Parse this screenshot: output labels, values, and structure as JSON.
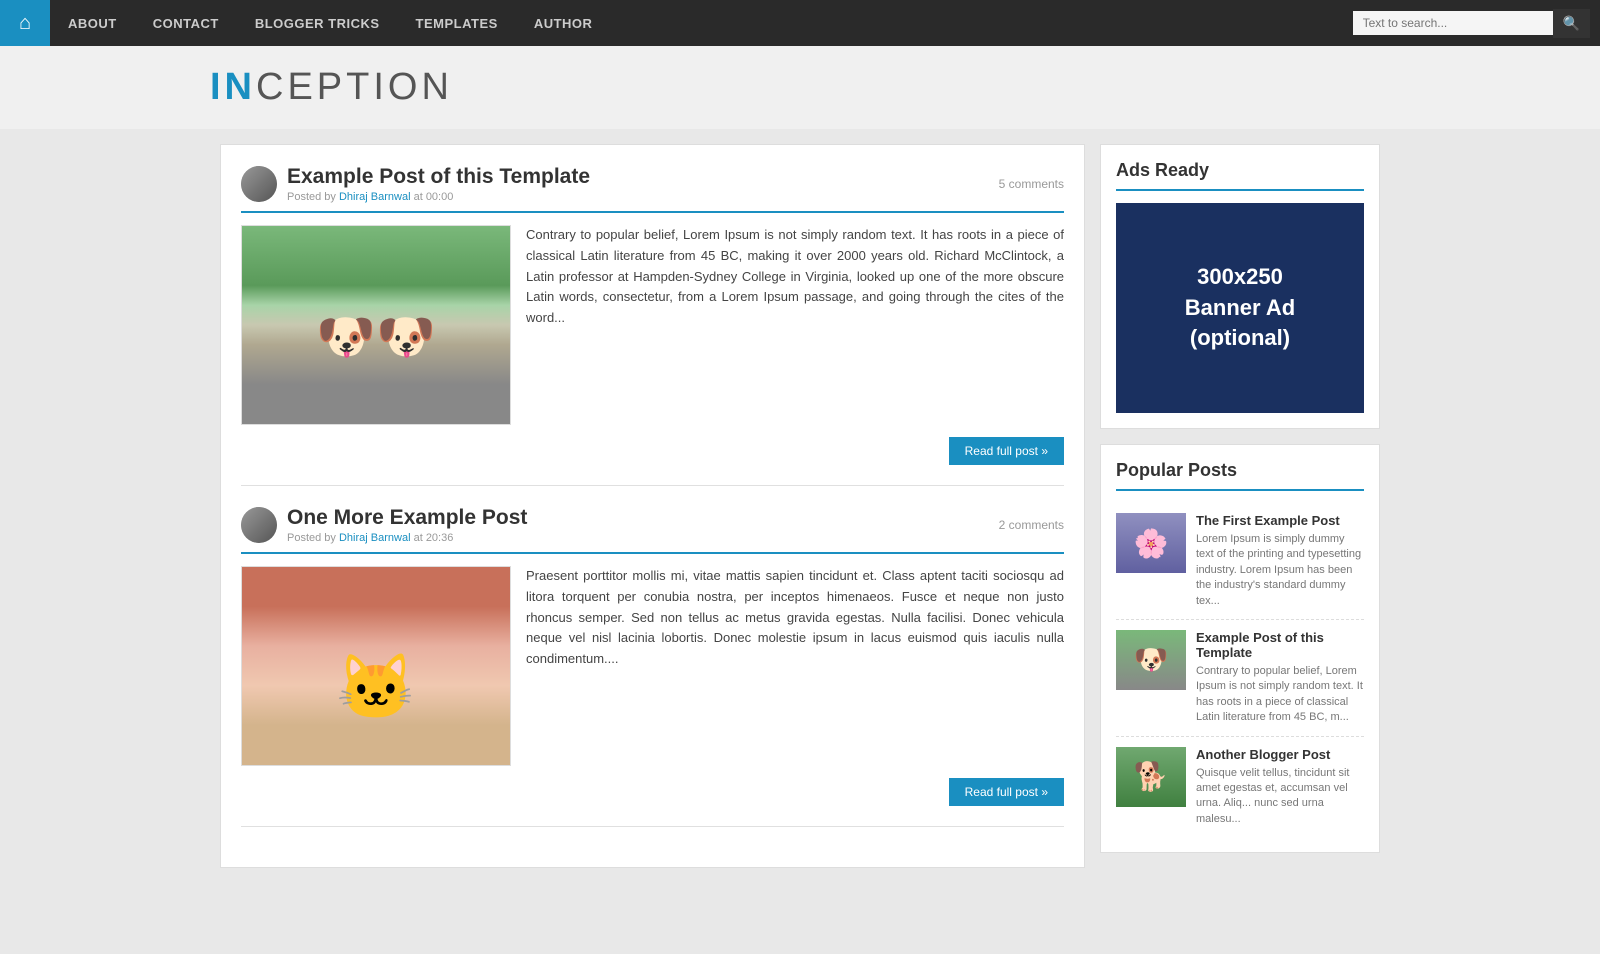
{
  "nav": {
    "home_icon": "⌂",
    "links": [
      {
        "id": "about",
        "label": "ABOUT"
      },
      {
        "id": "contact",
        "label": "CONTACT"
      },
      {
        "id": "blogger-tricks",
        "label": "BLOGGER TRICKS"
      },
      {
        "id": "templates",
        "label": "TEMPLATES"
      },
      {
        "id": "author",
        "label": "AUTHOR"
      }
    ],
    "search_placeholder": "Text to search...",
    "search_icon": "🔍"
  },
  "logo": {
    "part1": "IN",
    "part2": "CEPTION"
  },
  "posts": [
    {
      "id": "post1",
      "title": "Example Post of this Template",
      "author": "Dhiraj Barnwal",
      "time": "00:00",
      "comments": "5 comments",
      "image_type": "dogs",
      "excerpt": "Contrary to popular belief, Lorem Ipsum is not simply random text. It has roots in a piece of classical Latin literature from 45 BC, making it over 2000 years old. Richard McClintock, a Latin professor at Hampden-Sydney College in Virginia, looked up one of the more obscure Latin words, consectetur, from a Lorem Ipsum passage, and going through the cites of the word...",
      "read_more": "Read full post »",
      "posted_by": "Posted by"
    },
    {
      "id": "post2",
      "title": "One More Example Post",
      "author": "Dhiraj Barnwal",
      "time": "20:36",
      "comments": "2 comments",
      "image_type": "cat",
      "excerpt": "Praesent porttitor mollis mi, vitae mattis sapien tincidunt et. Class aptent taciti sociosqu ad litora torquent per conubia nostra, per inceptos himenaeos. Fusce et neque non justo rhoncus semper. Sed non tellus ac metus gravida egestas. Nulla facilisi. Donec vehicula neque vel nisl lacinia lobortis. Donec molestie ipsum in lacus euismod quis iaculis nulla condimentum....",
      "read_more": "Read full post »",
      "posted_by": "Posted by"
    }
  ],
  "sidebar": {
    "ads_title": "Ads Ready",
    "banner_line1": "300x250",
    "banner_line2": "Banner Ad",
    "banner_line3": "(optional)",
    "popular_title": "Popular Posts",
    "popular_posts": [
      {
        "id": "pop1",
        "title": "The First Example Post",
        "excerpt": "Lorem Ipsum is simply dummy text of the printing and typesetting industry. Lorem Ipsum has been the industry's standard dummy tex...",
        "image_type": "dogs2"
      },
      {
        "id": "pop2",
        "title": "Example Post of this Template",
        "excerpt": "Contrary to popular belief, Lorem Ipsum is not simply random text. It has roots in a piece of classical Latin literature from 45 BC, m...",
        "image_type": "dogs"
      },
      {
        "id": "pop3",
        "title": "Another Blogger Post",
        "excerpt": "Quisque velit tellus, tincidunt sit amet egestas et, accumsan vel urna. Aliq... nunc sed urna malesu...",
        "image_type": "green"
      }
    ]
  }
}
